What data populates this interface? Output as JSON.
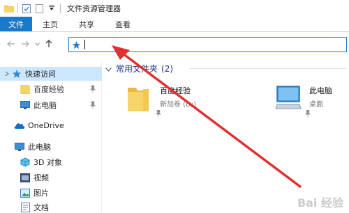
{
  "window": {
    "title": "文件资源管理器"
  },
  "ribbon": {
    "tabs": [
      {
        "label": "文件"
      },
      {
        "label": "主页"
      },
      {
        "label": "共享"
      },
      {
        "label": "查看"
      }
    ]
  },
  "address": {
    "value": ""
  },
  "sidebar": {
    "items": [
      {
        "label": "快速访问",
        "icon": "star-icon"
      },
      {
        "label": "百度经验",
        "icon": "folder-icon"
      },
      {
        "label": "此电脑",
        "icon": "computer-icon"
      },
      {
        "label": "OneDrive",
        "icon": "cloud-icon"
      },
      {
        "label": "此电脑",
        "icon": "computer-icon"
      },
      {
        "label": "3D 对象",
        "icon": "3d-objects-icon"
      },
      {
        "label": "视频",
        "icon": "video-icon"
      },
      {
        "label": "图片",
        "icon": "pictures-icon"
      },
      {
        "label": "文档",
        "icon": "documents-icon"
      }
    ]
  },
  "main": {
    "group_title": "常用文件夹",
    "group_count": "(2)",
    "tiles": [
      {
        "name": "百度经验",
        "sub": "新加卷 (D:)"
      },
      {
        "name": "此电脑",
        "sub": "桌面"
      }
    ]
  },
  "watermark": "Bai 经验",
  "colors": {
    "accent": "#1979ca",
    "selection": "#cce8ff",
    "annotation_arrow": "#e03030",
    "folder": "#f7d46a"
  }
}
